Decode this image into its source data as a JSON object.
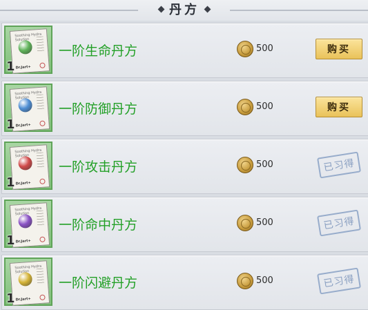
{
  "header": {
    "title": "丹方"
  },
  "items": [
    {
      "level": "1",
      "name": "一阶生命丹方",
      "price": "500",
      "action": "购买",
      "status": "buy",
      "orb_color": "#5fb35a",
      "paper_title": "Soothing Hydra Solution",
      "paper_brand": "Dr.Jart+"
    },
    {
      "level": "1",
      "name": "一阶防御丹方",
      "price": "500",
      "action": "购买",
      "status": "buy",
      "orb_color": "#4f8ed4",
      "paper_title": "Soothing Hydra Solution",
      "paper_brand": "Dr.Jart+"
    },
    {
      "level": "1",
      "name": "一阶攻击丹方",
      "price": "500",
      "action": "已习得",
      "status": "learned",
      "orb_color": "#d04a4a",
      "paper_title": "Soothing Hydra Solution",
      "paper_brand": "Dr.Jart+"
    },
    {
      "level": "1",
      "name": "一阶命中丹方",
      "price": "500",
      "action": "已习得",
      "status": "learned",
      "orb_color": "#8a52c4",
      "paper_title": "Soothing Hydra Solution",
      "paper_brand": "Dr.Jart+"
    },
    {
      "level": "1",
      "name": "一阶闪避丹方",
      "price": "500",
      "action": "已习得",
      "status": "learned",
      "orb_color": "#d4b337",
      "paper_title": "Soothing Hydra Solution",
      "paper_brand": "Dr.Jart+"
    }
  ]
}
